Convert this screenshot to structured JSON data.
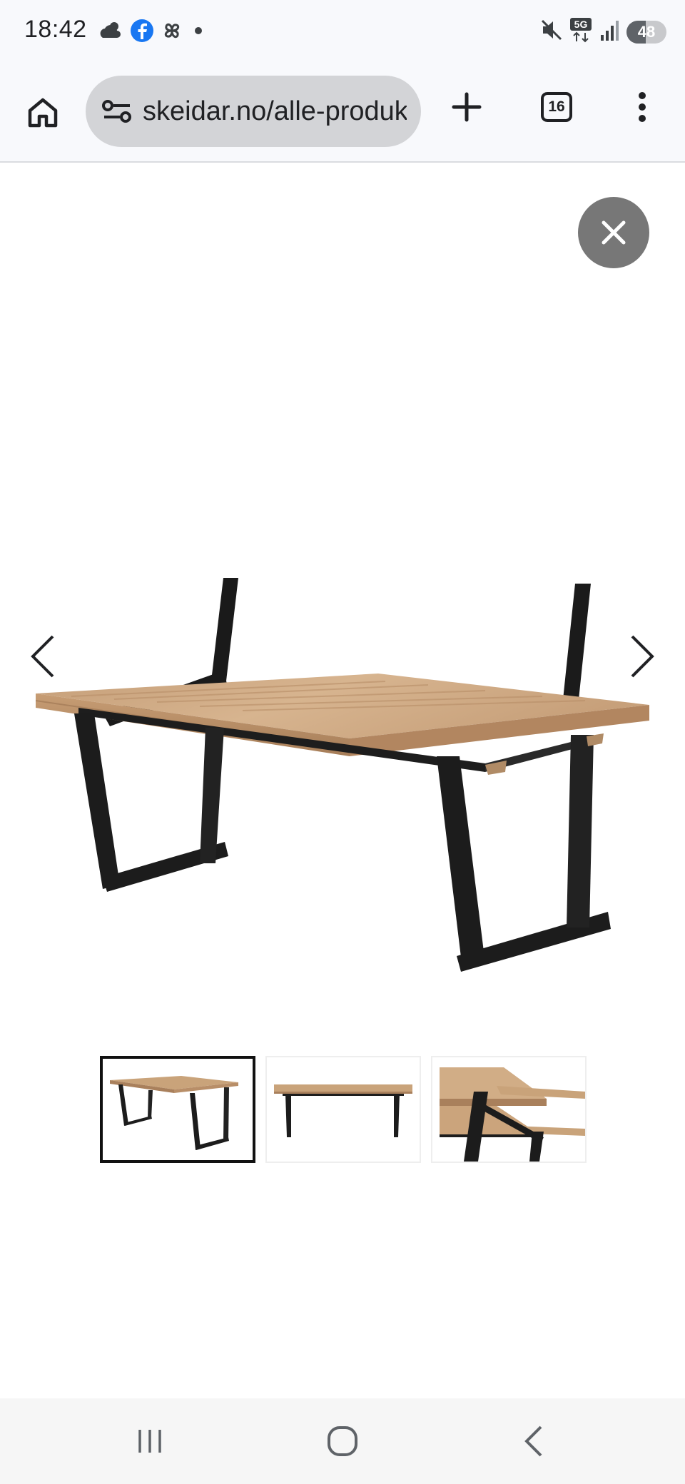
{
  "status_bar": {
    "time": "18:42",
    "left_icons": [
      "cloud-sun-icon",
      "facebook-icon",
      "pinwheel-icon",
      "dot-icon"
    ],
    "right_icons": [
      "mute-icon",
      "5g-icon",
      "signal-icon"
    ],
    "network_label": "5G",
    "battery_level": "48",
    "battery_fraction": 0.48
  },
  "browser": {
    "url": "skeidar.no/alle-produkter",
    "tab_count": "16",
    "icons": [
      "home-icon",
      "site-info-icon",
      "plus-icon",
      "tabs-icon",
      "more-vert-icon"
    ]
  },
  "gallery": {
    "main_image": "dining table with oak top and black trapezoid legs",
    "thumbnails": [
      {
        "description": "table perspective view",
        "selected": true
      },
      {
        "description": "table front view",
        "selected": false
      },
      {
        "description": "table extension detail",
        "selected": false
      }
    ],
    "controls": [
      "close-icon",
      "chevron-left-icon",
      "chevron-right-icon"
    ]
  },
  "nav_bar": {
    "buttons": [
      "recents-icon",
      "home-circle-icon",
      "back-icon"
    ]
  },
  "colors": {
    "chrome_bg": "#f8f9fc",
    "url_pill": "#d3d4d7",
    "close_button": "#777777",
    "wood": "#c9a37a",
    "leg": "#1c1c1c"
  }
}
